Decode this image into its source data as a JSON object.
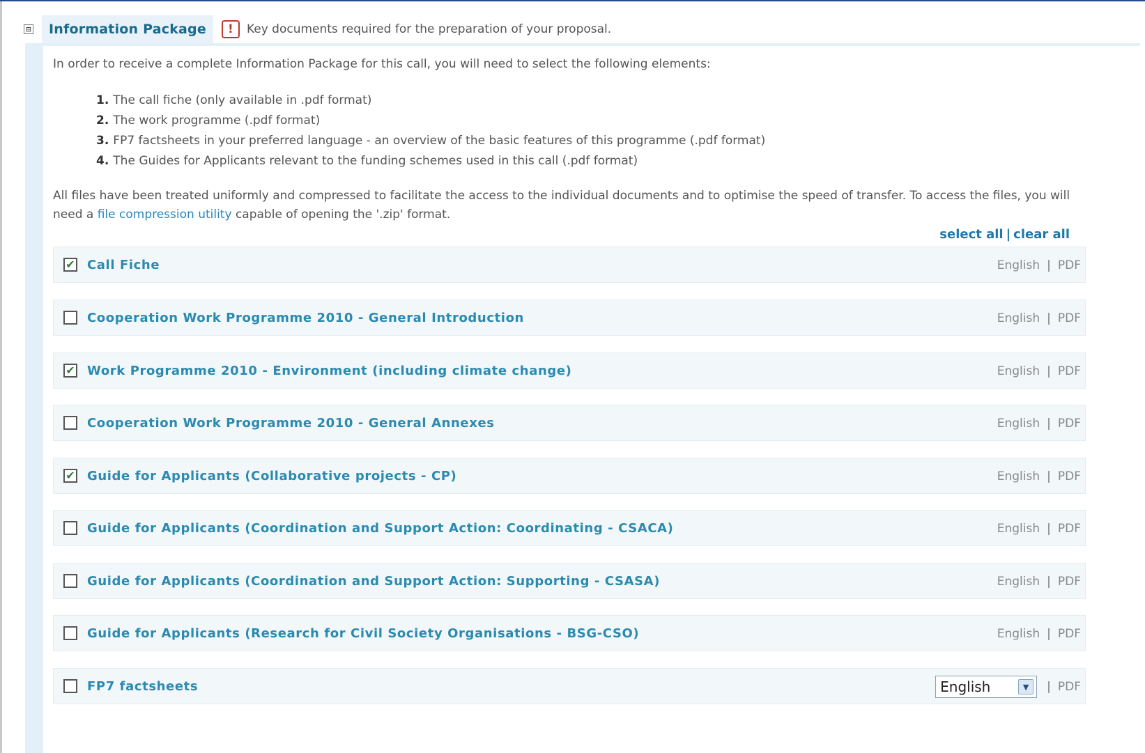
{
  "header": {
    "toggle": "⊟",
    "title": "Information Package",
    "alert_glyph": "!",
    "description": "Key documents required for the preparation of your proposal."
  },
  "intro": "In order to receive a complete Information Package for this call, you will need to select the following elements:",
  "requirements": [
    {
      "num": "1.",
      "text": "The call fiche (only available in .pdf format)"
    },
    {
      "num": "2.",
      "text": "The work programme (.pdf format)"
    },
    {
      "num": "3.",
      "text": "FP7 factsheets in your preferred language - an overview of the basic features of this programme (.pdf format)"
    },
    {
      "num": "4.",
      "text": "The Guides for Applicants relevant to the funding schemes used in this call (.pdf format)"
    }
  ],
  "files_note": {
    "before": "All files have been treated uniformly and compressed to facilitate the access to the individual documents and to optimise the speed of transfer. To access the files, you will need a ",
    "link": "file compression utility",
    "after": " capable of opening the '.zip' format."
  },
  "actions": {
    "select_all": "select all",
    "separator": "|",
    "clear_all": "clear all"
  },
  "documents": [
    {
      "label": "Call Fiche",
      "checked": true,
      "language": "English",
      "format": "PDF"
    },
    {
      "label": "Cooperation Work Programme 2010 - General Introduction",
      "checked": false,
      "language": "English",
      "format": "PDF"
    },
    {
      "label": "Work Programme 2010 - Environment (including climate change)",
      "checked": true,
      "language": "English",
      "format": "PDF"
    },
    {
      "label": "Cooperation Work Programme 2010 - General Annexes",
      "checked": false,
      "language": "English",
      "format": "PDF"
    },
    {
      "label": "Guide for Applicants (Collaborative projects - CP)",
      "checked": true,
      "language": "English",
      "format": "PDF"
    },
    {
      "label": "Guide for Applicants (Coordination and Support Action: Coordinating - CSACA)",
      "checked": false,
      "language": "English",
      "format": "PDF"
    },
    {
      "label": "Guide for Applicants (Coordination and Support Action: Supporting - CSASA)",
      "checked": false,
      "language": "English",
      "format": "PDF"
    },
    {
      "label": "Guide for Applicants (Research for Civil Society Organisations - BSG-CSO)",
      "checked": false,
      "language": "English",
      "format": "PDF"
    }
  ],
  "factsheets": {
    "label": "FP7 factsheets",
    "checked": false,
    "language_selected": "English",
    "format": "PDF"
  },
  "meta_separator": "|",
  "check_glyph": "✔",
  "dropdown_glyph": "▼"
}
